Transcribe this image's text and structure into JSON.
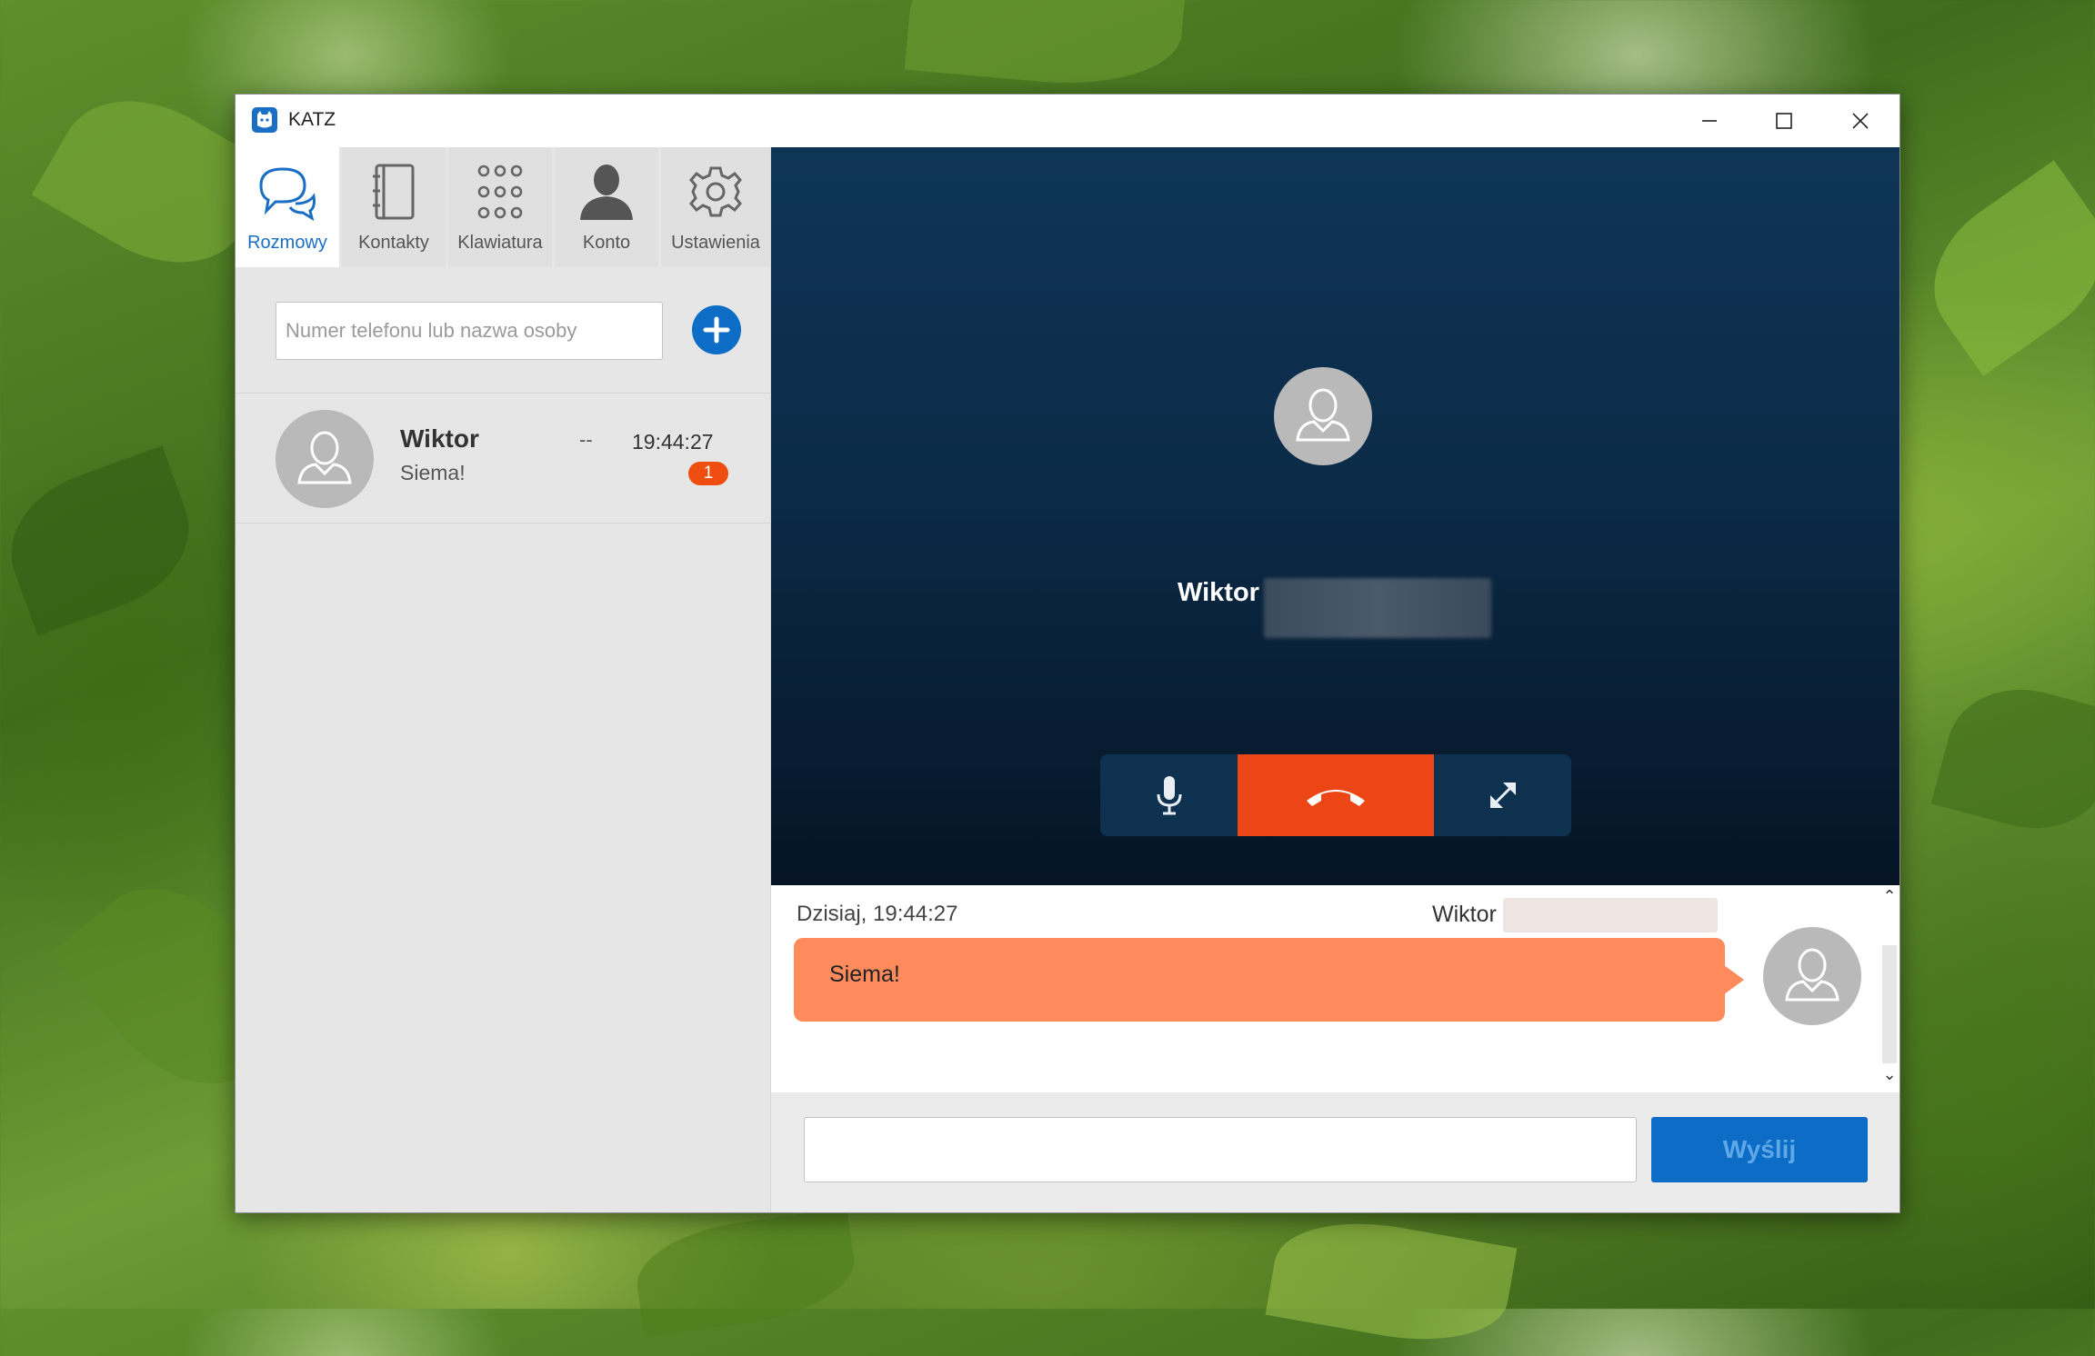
{
  "app": {
    "title": "KATZ",
    "accent": "#1a6fc4",
    "brand_orange": "#ec4516"
  },
  "window_controls": {
    "minimize": "minimize-icon",
    "maximize": "maximize-icon",
    "close": "close-icon"
  },
  "tabs": [
    {
      "id": "rozmowy",
      "label": "Rozmowy",
      "icon": "chat-bubbles-icon",
      "active": true
    },
    {
      "id": "kontakty",
      "label": "Kontakty",
      "icon": "address-book-icon",
      "active": false
    },
    {
      "id": "klawiatura",
      "label": "Klawiatura",
      "icon": "dialpad-icon",
      "active": false
    },
    {
      "id": "konto",
      "label": "Konto",
      "icon": "user-icon",
      "active": false
    },
    {
      "id": "ustawienia",
      "label": "Ustawienia",
      "icon": "gear-icon",
      "active": false
    }
  ],
  "search": {
    "placeholder": "Numer telefonu lub nazwa osoby",
    "value": "",
    "add_icon": "plus-icon"
  },
  "conversations": [
    {
      "name": "Wiktor",
      "last_message": "Siema!",
      "status": "--",
      "time": "19:44:27",
      "unread": "1"
    }
  ],
  "call": {
    "contact_name": "Wiktor",
    "controls": {
      "mute": "microphone-icon",
      "hangup": "hang-up-icon",
      "fullscreen": "expand-icon"
    }
  },
  "chat": {
    "date": "Dzisiaj, 19:44:27",
    "sender": "Wiktor",
    "messages": [
      {
        "text": "Siema!"
      }
    ]
  },
  "composer": {
    "value": "",
    "send_label": "Wyślij"
  }
}
